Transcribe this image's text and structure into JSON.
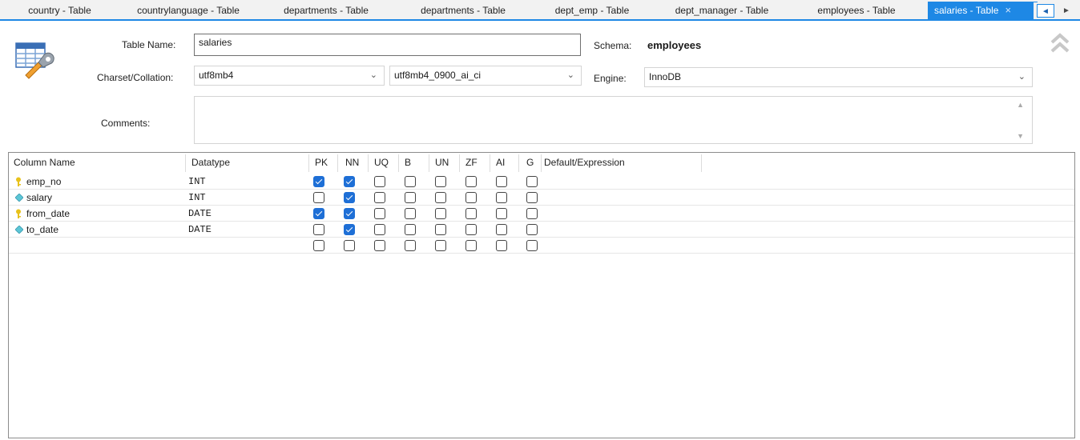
{
  "tabs": [
    {
      "label": "country - Table"
    },
    {
      "label": "countrylanguage - Table"
    },
    {
      "label": "departments - Table"
    },
    {
      "label": "departments - Table"
    },
    {
      "label": "dept_emp - Table"
    },
    {
      "label": "dept_manager - Table"
    },
    {
      "label": "employees - Table"
    },
    {
      "label": "salaries - Table",
      "active": true
    }
  ],
  "tab_close_glyph": "×",
  "form": {
    "table_name_label": "Table Name:",
    "table_name_value": "salaries",
    "schema_label": "Schema:",
    "schema_value": "employees",
    "charset_label": "Charset/Collation:",
    "charset_value": "utf8mb4",
    "collation_value": "utf8mb4_0900_ai_ci",
    "engine_label": "Engine:",
    "engine_value": "InnoDB",
    "comments_label": "Comments:",
    "comments_value": ""
  },
  "grid": {
    "headers": [
      "Column Name",
      "Datatype",
      "PK",
      "NN",
      "UQ",
      "B",
      "UN",
      "ZF",
      "AI",
      "G",
      "Default/Expression"
    ],
    "flag_columns": [
      "PK",
      "NN",
      "UQ",
      "B",
      "UN",
      "ZF",
      "AI",
      "G"
    ],
    "rows": [
      {
        "name": "emp_no",
        "icon": "key-icon",
        "datatype": "INT",
        "flags": [
          true,
          true,
          false,
          false,
          false,
          false,
          false,
          false
        ],
        "default": ""
      },
      {
        "name": "salary",
        "icon": "diamond-icon",
        "datatype": "INT",
        "flags": [
          false,
          true,
          false,
          false,
          false,
          false,
          false,
          false
        ],
        "default": ""
      },
      {
        "name": "from_date",
        "icon": "key-icon",
        "datatype": "DATE",
        "flags": [
          true,
          true,
          false,
          false,
          false,
          false,
          false,
          false
        ],
        "default": ""
      },
      {
        "name": "to_date",
        "icon": "diamond-icon",
        "datatype": "DATE",
        "flags": [
          false,
          true,
          false,
          false,
          false,
          false,
          false,
          false
        ],
        "default": ""
      },
      {
        "name": "",
        "icon": "",
        "datatype": "",
        "flags": [
          false,
          false,
          false,
          false,
          false,
          false,
          false,
          false
        ],
        "default": ""
      }
    ]
  },
  "colors": {
    "accent": "#1e88e5",
    "checkbox_checked": "#1e6fd6",
    "key_icon": "#e8c21c",
    "column_icon": "#5cc6d6"
  }
}
